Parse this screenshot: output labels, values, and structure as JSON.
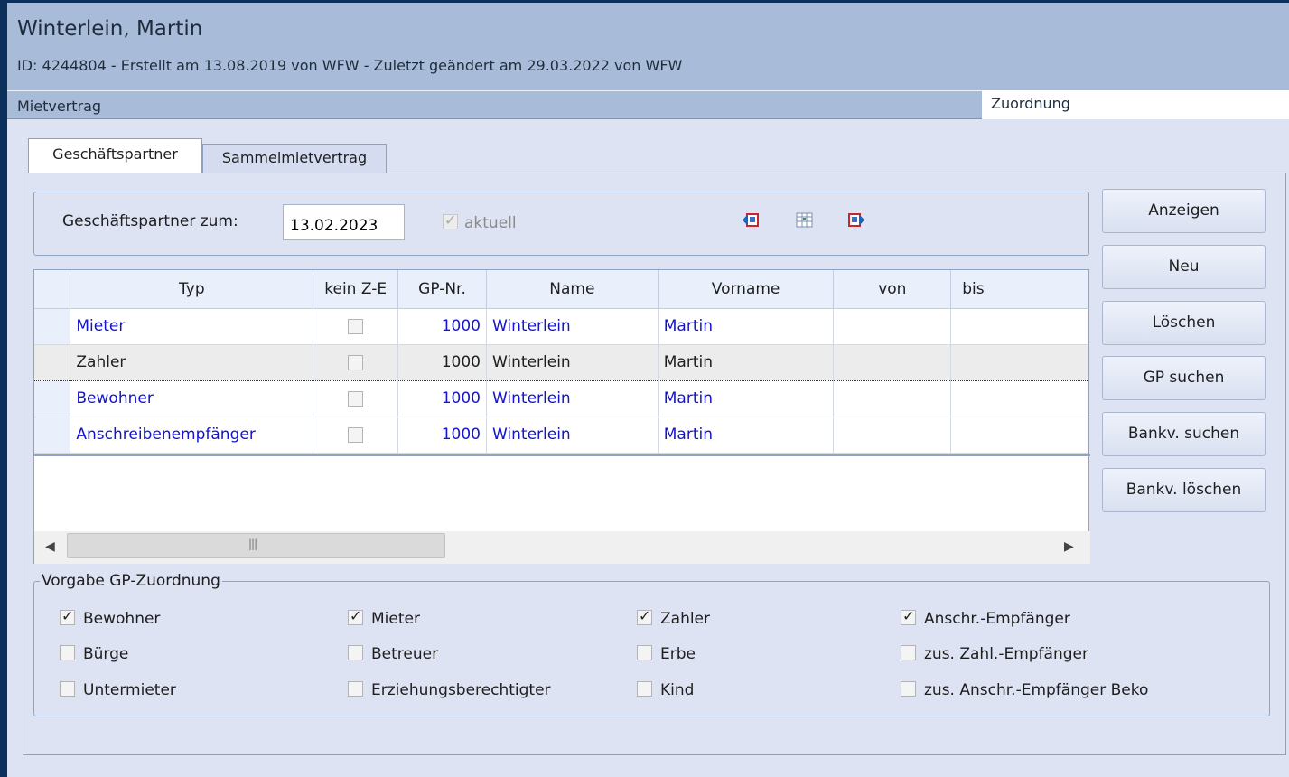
{
  "header": {
    "title": "Winterlein, Martin",
    "subtitle": "ID: 4244804 - Erstellt am 13.08.2019 von WFW - Zuletzt geändert am 29.03.2022 von WFW"
  },
  "section_bar": {
    "label": "Mietvertrag",
    "active_tab": "Zuordnung"
  },
  "tabs": [
    {
      "label": "Geschäftspartner",
      "active": true
    },
    {
      "label": "Sammelmietvertrag",
      "active": false
    }
  ],
  "filter": {
    "label": "Geschäftspartner zum:",
    "date_value": "13.02.2023",
    "aktuell_label": "aktuell",
    "aktuell_checked": true
  },
  "nav_icons": [
    "previous-period-icon",
    "calendar-grid-icon",
    "next-period-icon"
  ],
  "grid": {
    "columns": [
      "Typ",
      "kein Z-E",
      "GP-Nr.",
      "Name",
      "Vorname",
      "von",
      "bis"
    ],
    "rows": [
      {
        "typ": "Mieter",
        "kein_ze": false,
        "gp_nr": "1000",
        "name": "Winterlein",
        "vorname": "Martin",
        "von": "",
        "bis": ""
      },
      {
        "typ": "Zahler",
        "kein_ze": false,
        "gp_nr": "1000",
        "name": "Winterlein",
        "vorname": "Martin",
        "von": "",
        "bis": ""
      },
      {
        "typ": "Bewohner",
        "kein_ze": false,
        "gp_nr": "1000",
        "name": "Winterlein",
        "vorname": "Martin",
        "von": "",
        "bis": ""
      },
      {
        "typ": "Anschreibenempfänger",
        "kein_ze": false,
        "gp_nr": "1000",
        "name": "Winterlein",
        "vorname": "Martin",
        "von": "",
        "bis": ""
      }
    ],
    "selected_row": 1
  },
  "buttons": {
    "anzeigen": "Anzeigen",
    "neu": "Neu",
    "loeschen": "Löschen",
    "gp_suchen": "GP suchen",
    "bankv_suchen": "Bankv. suchen",
    "bankv_loeschen": "Bankv. löschen"
  },
  "vorgabe": {
    "legend": "Vorgabe GP-Zuordnung",
    "options": [
      {
        "label": "Bewohner",
        "checked": true
      },
      {
        "label": "Mieter",
        "checked": true
      },
      {
        "label": "Zahler",
        "checked": true
      },
      {
        "label": "Anschr.-Empfänger",
        "checked": true
      },
      {
        "label": "Bürge",
        "checked": false
      },
      {
        "label": "Betreuer",
        "checked": false
      },
      {
        "label": "Erbe",
        "checked": false
      },
      {
        "label": "zus. Zahl.-Empfänger",
        "checked": false
      },
      {
        "label": "Untermieter",
        "checked": false
      },
      {
        "label": "Erziehungsberechtigter",
        "checked": false
      },
      {
        "label": "Kind",
        "checked": false
      },
      {
        "label": "zus. Anschr.-Empfänger Beko",
        "checked": false
      }
    ]
  }
}
